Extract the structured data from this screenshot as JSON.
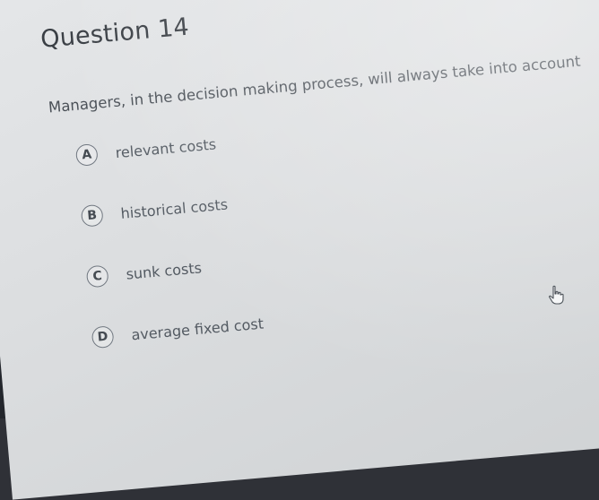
{
  "question": {
    "title": "Question 14",
    "text": "Managers, in the decision making process, will always take into account"
  },
  "options": [
    {
      "letter": "A",
      "label": "relevant costs"
    },
    {
      "letter": "B",
      "label": "historical costs"
    },
    {
      "letter": "C",
      "label": "sunk costs"
    },
    {
      "letter": "D",
      "label": "average fixed cost"
    }
  ],
  "icons": {
    "cursor": "hand-pointer-icon"
  }
}
